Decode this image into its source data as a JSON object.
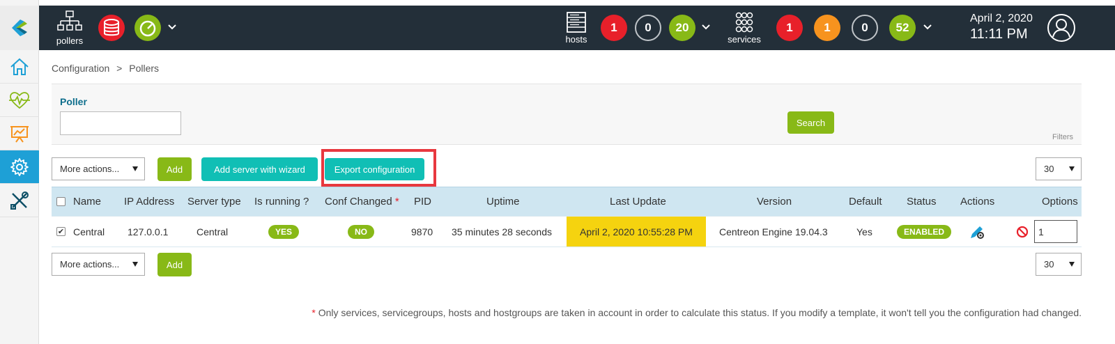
{
  "topbar": {
    "pollers_label": "pollers",
    "hosts_label": "hosts",
    "services_label": "services",
    "host_counts": {
      "down": "1",
      "unreachable": "0",
      "up": "20"
    },
    "service_counts": {
      "critical": "1",
      "warning": "1",
      "unknown": "0",
      "ok": "52"
    },
    "date": "April 2, 2020",
    "time": "11:11 PM"
  },
  "breadcrumb": {
    "level1": "Configuration",
    "separator": ">",
    "level2": "Pollers"
  },
  "filter": {
    "label": "Poller",
    "value": "",
    "search_button": "Search",
    "filters_link": "Filters"
  },
  "toolbar_top": {
    "more_actions": "More actions...",
    "add": "Add",
    "add_wizard": "Add server with wizard",
    "export": "Export configuration",
    "page_size": "30"
  },
  "toolbar_bottom": {
    "more_actions": "More actions...",
    "add": "Add",
    "page_size": "30"
  },
  "table": {
    "headers": {
      "name": "Name",
      "ip": "IP Address",
      "server_type": "Server type",
      "running": "Is running ?",
      "conf_changed": "Conf Changed",
      "star": "*",
      "pid": "PID",
      "uptime": "Uptime",
      "last_update": "Last Update",
      "version": "Version",
      "default": "Default",
      "status": "Status",
      "actions": "Actions",
      "options": "Options"
    },
    "rows": [
      {
        "checked": "✔",
        "name": "Central",
        "ip": "127.0.0.1",
        "server_type": "Central",
        "running": "YES",
        "conf_changed": "NO",
        "pid": "9870",
        "uptime": "35 minutes 28 seconds",
        "last_update": "April 2, 2020 10:55:28 PM",
        "version": "Centreon Engine 19.04.3",
        "default": "Yes",
        "status": "ENABLED",
        "option_value": "1"
      }
    ]
  },
  "footnote": {
    "star": "*",
    "text": "Only services, servicegroups, hosts and hostgroups are taken in account in order to calculate this status. If you modify a template, it won't tell you the configuration had changed."
  },
  "colors": {
    "accent_blue": "#1ea0d6",
    "ok_green": "#88b917",
    "teal": "#10bfb5",
    "critical_red": "#e8202a",
    "warning_orange": "#f7931e",
    "highlight_yellow": "#f5d30f"
  }
}
